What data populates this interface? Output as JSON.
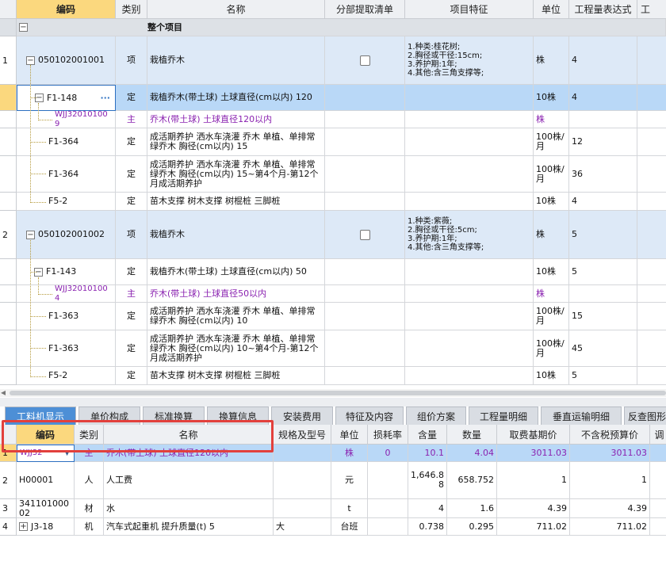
{
  "top_headers": [
    "编码",
    "类别",
    "名称",
    "分部提取清单",
    "项目特征",
    "单位",
    "工程量表达式",
    "工"
  ],
  "root": {
    "minus": "−",
    "name": "整个项目"
  },
  "rows": [
    {
      "num": "1",
      "code": "050102001001",
      "type": "项",
      "name": "栽植乔木",
      "feature": "1.种类:桂花树;\n2.胸径或干径:15cm;\n3.养护期:1年;\n4.其他:含三角支撑等;",
      "unit": "株",
      "expr": "4"
    },
    {
      "code": "F1-148",
      "type": "定",
      "name": "栽植乔木(带土球) 土球直径(cm以内) 120",
      "unit": "10株",
      "expr": "4",
      "dots": "···"
    },
    {
      "code": "WJJ320101009",
      "type": "主",
      "name": "乔木(带土球) 土球直径120以内",
      "unit": "株",
      "expr": ""
    },
    {
      "code": "F1-364",
      "type": "定",
      "name": "成活期养护 洒水车浇灌 乔木 单植、单排常绿乔木 胸径(cm以内) 15",
      "unit": "100株/月",
      "expr": "12"
    },
    {
      "code": "F1-364",
      "type": "定",
      "name": "成活期养护 洒水车浇灌 乔木 单植、单排常绿乔木 胸径(cm以内) 15~第4个月-第12个月成活期养护",
      "unit": "100株/月",
      "expr": "36"
    },
    {
      "code": "F5-2",
      "type": "定",
      "name": "苗木支撑 树木支撑 树棍桩 三脚桩",
      "unit": "10株",
      "expr": "4"
    },
    {
      "num": "2",
      "code": "050102001002",
      "type": "项",
      "name": "栽植乔木",
      "feature": "1.种类:紫薇;\n2.胸径或干径:5cm;\n3.养护期:1年;\n4.其他:含三角支撑等;",
      "unit": "株",
      "expr": "5"
    },
    {
      "code": "F1-143",
      "type": "定",
      "name": "栽植乔木(带土球) 土球直径(cm以内) 50",
      "unit": "10株",
      "expr": "5"
    },
    {
      "code": "WJJ320101004",
      "type": "主",
      "name": "乔木(带土球) 土球直径50以内",
      "unit": "株",
      "expr": ""
    },
    {
      "code": "F1-363",
      "type": "定",
      "name": "成活期养护 洒水车浇灌 乔木 单植、单排常绿乔木 胸径(cm以内) 10",
      "unit": "100株/月",
      "expr": "15"
    },
    {
      "code": "F1-363",
      "type": "定",
      "name": "成活期养护 洒水车浇灌 乔木 单植、单排常绿乔木 胸径(cm以内) 10~第4个月-第12个月成活期养护",
      "unit": "100株/月",
      "expr": "45"
    },
    {
      "code": "F5-2",
      "type": "定",
      "name": "苗木支撑 树木支撑 树棍桩 三脚桩",
      "unit": "10株",
      "expr": "5"
    }
  ],
  "tabs": [
    "工料机显示",
    "单价构成",
    "标准换算",
    "换算信息",
    "安装费用",
    "特征及内容",
    "组价方案",
    "工程量明细",
    "垂直运输明细",
    "反查图形"
  ],
  "bottom_headers": [
    "编码",
    "类别",
    "名称",
    "规格及型号",
    "单位",
    "损耗率",
    "含量",
    "数量",
    "取费基期价",
    "不含税预算价",
    "调"
  ],
  "bottom_rows": [
    {
      "num": "1",
      "code": "WJJ32···",
      "type": "主",
      "name": "乔木(带土球) 土球直径120以内",
      "spec": "",
      "unit": "株",
      "loss": "0",
      "qty": "10.1",
      "amount": "4.04",
      "base": "3011.03",
      "price": "3011.03"
    },
    {
      "num": "2",
      "code": "H00001",
      "type": "人",
      "name": "人工费",
      "spec": "",
      "unit": "元",
      "loss": "",
      "qty": "1,646.88",
      "amount": "658.752",
      "base": "1",
      "price": "1"
    },
    {
      "num": "3",
      "code": "34110100002",
      "type": "材",
      "name": "水",
      "spec": "",
      "unit": "t",
      "loss": "",
      "qty": "4",
      "amount": "1.6",
      "base": "4.39",
      "price": "4.39"
    },
    {
      "num": "4",
      "code": "J3-18",
      "type": "机",
      "name": "汽车式起重机 提升质量(t) 5",
      "spec": "大",
      "unit": "台班",
      "loss": "",
      "qty": "0.738",
      "amount": "0.295",
      "base": "711.02",
      "price": "711.02",
      "plus": "+"
    }
  ],
  "colors": {
    "highlight_box": "#e2403c",
    "selected_row": "#b9d8f7",
    "bill_row": "#dde9f7",
    "material": "#8a22b0"
  }
}
